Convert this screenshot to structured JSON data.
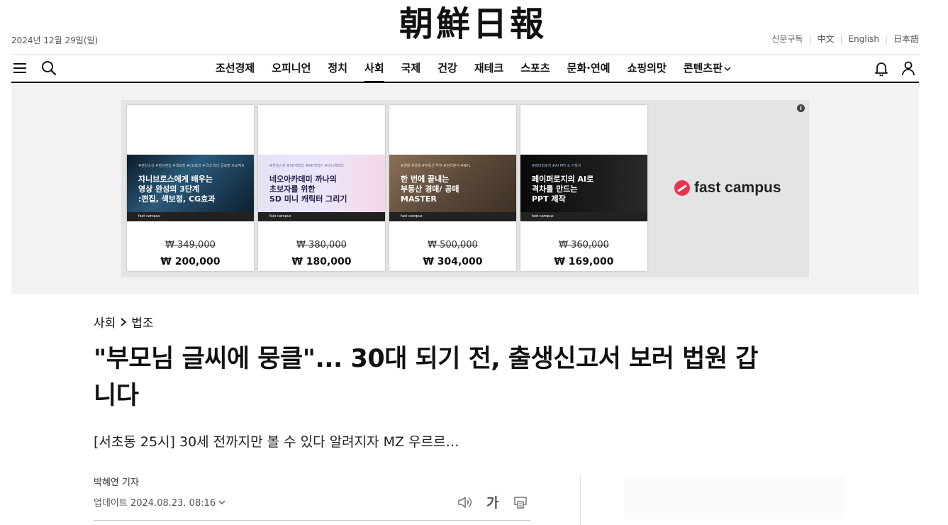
{
  "header": {
    "date": "2024년 12월 29일(일)",
    "logo_text": "朝鮮日報",
    "links": [
      "신문구독",
      "中文",
      "English",
      "日本語"
    ]
  },
  "nav": {
    "items": [
      {
        "label": "조선경제",
        "active": false
      },
      {
        "label": "오피니언",
        "active": false
      },
      {
        "label": "정치",
        "active": false
      },
      {
        "label": "사회",
        "active": true
      },
      {
        "label": "국제",
        "active": false
      },
      {
        "label": "건강",
        "active": false
      },
      {
        "label": "재테크",
        "active": false
      },
      {
        "label": "스포츠",
        "active": false
      },
      {
        "label": "문화·연예",
        "active": false
      },
      {
        "label": "쇼핑의맛",
        "active": false
      },
      {
        "label": "콘텐츠판",
        "active": false
      }
    ],
    "more_icon": "chevron-down-icon"
  },
  "ad": {
    "info_label": "i",
    "brand": "fast campus",
    "cards": [
      {
        "tags": "#영상소싱 #영상편집 #색보정 #CG효과 #국내 최다 글로벌 프로젝트",
        "text": "쟈니브로스에게 배우는\n영상 완성의 3단계\n:편집, 색보정, CG효과",
        "foot": "fast campus",
        "bg": "#1a2a3a",
        "orig_price": "₩ 349,000",
        "price": "₩ 200,000"
      },
      {
        "tags": "#한정스핀 #SD캐릭터 #AD캐릭터 #미니캐릭터",
        "text": "네오아카데미 까나의\n초보자를 위한\nSD 미니 캐릭터 그리기",
        "foot": "fast campus",
        "bg": "#e8e4f6",
        "orig_price": "₩ 380,000",
        "price": "₩ 180,000"
      },
      {
        "tags": "#경매 #공매 #부동산 투자 #권리분석 #NPL",
        "text": "한 번에 끝내는\n부동산 경매/ 공매\nMASTER",
        "foot": "fast campus",
        "bg": "#6b5a4a",
        "orig_price": "₩ 500,000",
        "price": "₩ 304,000"
      },
      {
        "tags": "#페이퍼로지 #AI PPT & 기획서",
        "text": "페이퍼로지의 AI로\n격차를 만드는\nPPT 제작",
        "foot": "fast campus",
        "bg": "#111111",
        "orig_price": "₩ 360,000",
        "price": "₩ 169,000"
      }
    ]
  },
  "article": {
    "breadcrumb": [
      "사회",
      "법조"
    ],
    "headline": "\"부모님 글씨에 뭉클\"... 30대 되기 전, 출생신고서 보러 법원 갑니다",
    "subhead": "[서초동 25시] 30세 전까지만 볼 수 있다 알려지자 MZ 우르르…",
    "author": "박혜연 기자",
    "updated": "업데이트 2024.08.23. 08:16",
    "font_size_label": "가"
  },
  "colors": {
    "accent": "#111111",
    "brand_red": "#e8344e"
  }
}
